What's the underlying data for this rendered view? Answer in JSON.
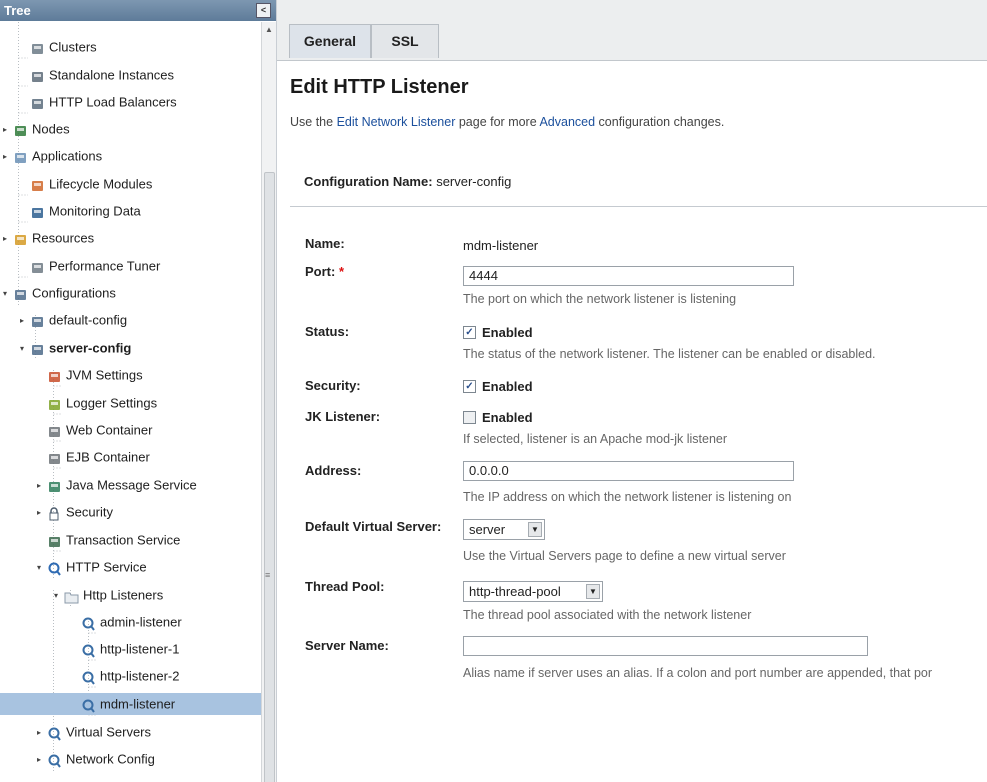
{
  "tree": {
    "title": "Tree",
    "collapse_glyph": "<",
    "items": [
      {
        "label": "Clusters",
        "icon": "clusters-icon",
        "expander": ""
      },
      {
        "label": "Standalone Instances",
        "icon": "standalone-instance-icon",
        "expander": ""
      },
      {
        "label": "HTTP Load Balancers",
        "icon": "load-balancer-icon",
        "expander": ""
      },
      {
        "label": "Nodes",
        "icon": "nodes-icon",
        "expander": "▸"
      },
      {
        "label": "Applications",
        "icon": "applications-icon",
        "expander": "▸"
      },
      {
        "label": "Lifecycle Modules",
        "icon": "lifecycle-modules-icon",
        "expander": ""
      },
      {
        "label": "Monitoring Data",
        "icon": "monitoring-data-icon",
        "expander": ""
      },
      {
        "label": "Resources",
        "icon": "resources-icon",
        "expander": "▸"
      },
      {
        "label": "Performance Tuner",
        "icon": "performance-tuner-icon",
        "expander": ""
      },
      {
        "label": "Configurations",
        "icon": "configurations-icon",
        "expander": "▾"
      },
      {
        "label": "default-config",
        "icon": "config-icon",
        "expander": "▸"
      },
      {
        "label": "server-config",
        "icon": "config-icon",
        "expander": "▾"
      },
      {
        "label": "JVM Settings",
        "icon": "jvm-settings-icon",
        "expander": ""
      },
      {
        "label": "Logger Settings",
        "icon": "logger-settings-icon",
        "expander": ""
      },
      {
        "label": "Web Container",
        "icon": "web-container-icon",
        "expander": ""
      },
      {
        "label": "EJB Container",
        "icon": "ejb-container-icon",
        "expander": ""
      },
      {
        "label": "Java Message Service",
        "icon": "jms-icon",
        "expander": "▸"
      },
      {
        "label": "Security",
        "icon": "security-lock-icon",
        "expander": "▸"
      },
      {
        "label": "Transaction Service",
        "icon": "transaction-service-icon",
        "expander": ""
      },
      {
        "label": "HTTP Service",
        "icon": "http-service-icon",
        "expander": "▾"
      },
      {
        "label": "Http Listeners",
        "icon": "folder-icon",
        "expander": "▾"
      },
      {
        "label": "admin-listener",
        "icon": "listener-icon",
        "expander": ""
      },
      {
        "label": "http-listener-1",
        "icon": "listener-icon",
        "expander": ""
      },
      {
        "label": "http-listener-2",
        "icon": "listener-icon",
        "expander": ""
      },
      {
        "label": "mdm-listener",
        "icon": "listener-icon",
        "expander": ""
      },
      {
        "label": "Virtual Servers",
        "icon": "virtual-servers-icon",
        "expander": "▸"
      },
      {
        "label": "Network Config",
        "icon": "network-config-icon",
        "expander": "▸"
      }
    ]
  },
  "tabs": [
    {
      "label": "General"
    },
    {
      "label": "SSL"
    }
  ],
  "page": {
    "title": "Edit HTTP Listener",
    "help_prefix": "Use the ",
    "help_link1": "Edit Network Listener",
    "help_middle": " page for more ",
    "help_link2": "Advanced",
    "help_suffix": " configuration changes.",
    "config_label": "Configuration Name:",
    "config_value": "server-config"
  },
  "form": {
    "name_label": "Name:",
    "name_value": "mdm-listener",
    "port_label": "Port:",
    "port_required": "*",
    "port_value": "4444",
    "port_help": "The port on which the network listener is listening",
    "status_label": "Status:",
    "status_checkbox_label": "Enabled",
    "status_checked": true,
    "status_help": "The status of the network listener. The listener can be enabled or disabled.",
    "security_label": "Security:",
    "security_checkbox_label": "Enabled",
    "security_checked": true,
    "jk_label": "JK Listener:",
    "jk_checkbox_label": "Enabled",
    "jk_checked": false,
    "jk_help": "If selected, listener is an Apache mod-jk listener",
    "address_label": "Address:",
    "address_value": "0.0.0.0",
    "address_help": "The IP address on which the network listener is listening on",
    "dvs_label": "Default Virtual Server:",
    "dvs_value": "server",
    "dvs_help": "Use the Virtual Servers page to define a new virtual server",
    "thread_label": "Thread Pool:",
    "thread_value": "http-thread-pool",
    "thread_help": "The thread pool associated with the network listener",
    "server_name_label": "Server Name:",
    "server_name_value": "",
    "server_name_help": "Alias name if server uses an alias. If a colon and port number are appended, that por"
  },
  "colors": {
    "tree_header": "#6b87a4",
    "selection": "#a8c3e0",
    "link": "#1b4f9c",
    "required": "#dd1111"
  }
}
